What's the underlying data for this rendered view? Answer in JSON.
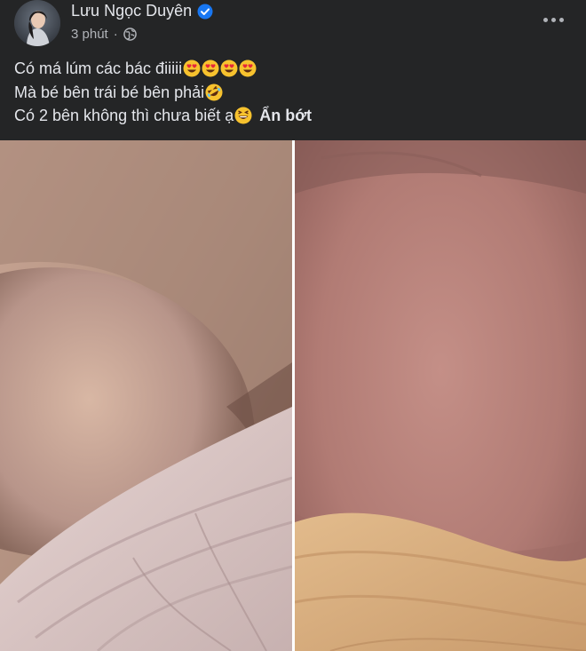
{
  "post": {
    "author": "Lưu Ngọc Duyên",
    "time": "3 phút",
    "separator": "·",
    "privacy_icon": "globe-icon",
    "verified_icon": "verified-badge-icon",
    "text_lines": [
      {
        "text": "Có má lúm các bác điiiii",
        "emoji": [
          "heart-eyes",
          "heart-eyes",
          "heart-eyes",
          "heart-eyes"
        ]
      },
      {
        "text": "Mà bé bên trái bé bên phải",
        "emoji": [
          "rofl"
        ]
      },
      {
        "text": "Có 2 bên không thì chưa biết ạ",
        "emoji": [
          "grinning-squint"
        ]
      }
    ],
    "see_less": "Ẩn bớt",
    "photos": [
      {
        "name": "baby-cheek-left-photo"
      },
      {
        "name": "baby-cheek-right-photo"
      }
    ]
  },
  "colors": {
    "background": "#242526",
    "primary_text": "#e4e6eb",
    "secondary_text": "#b0b3b8",
    "verified_blue": "#1877f2"
  }
}
